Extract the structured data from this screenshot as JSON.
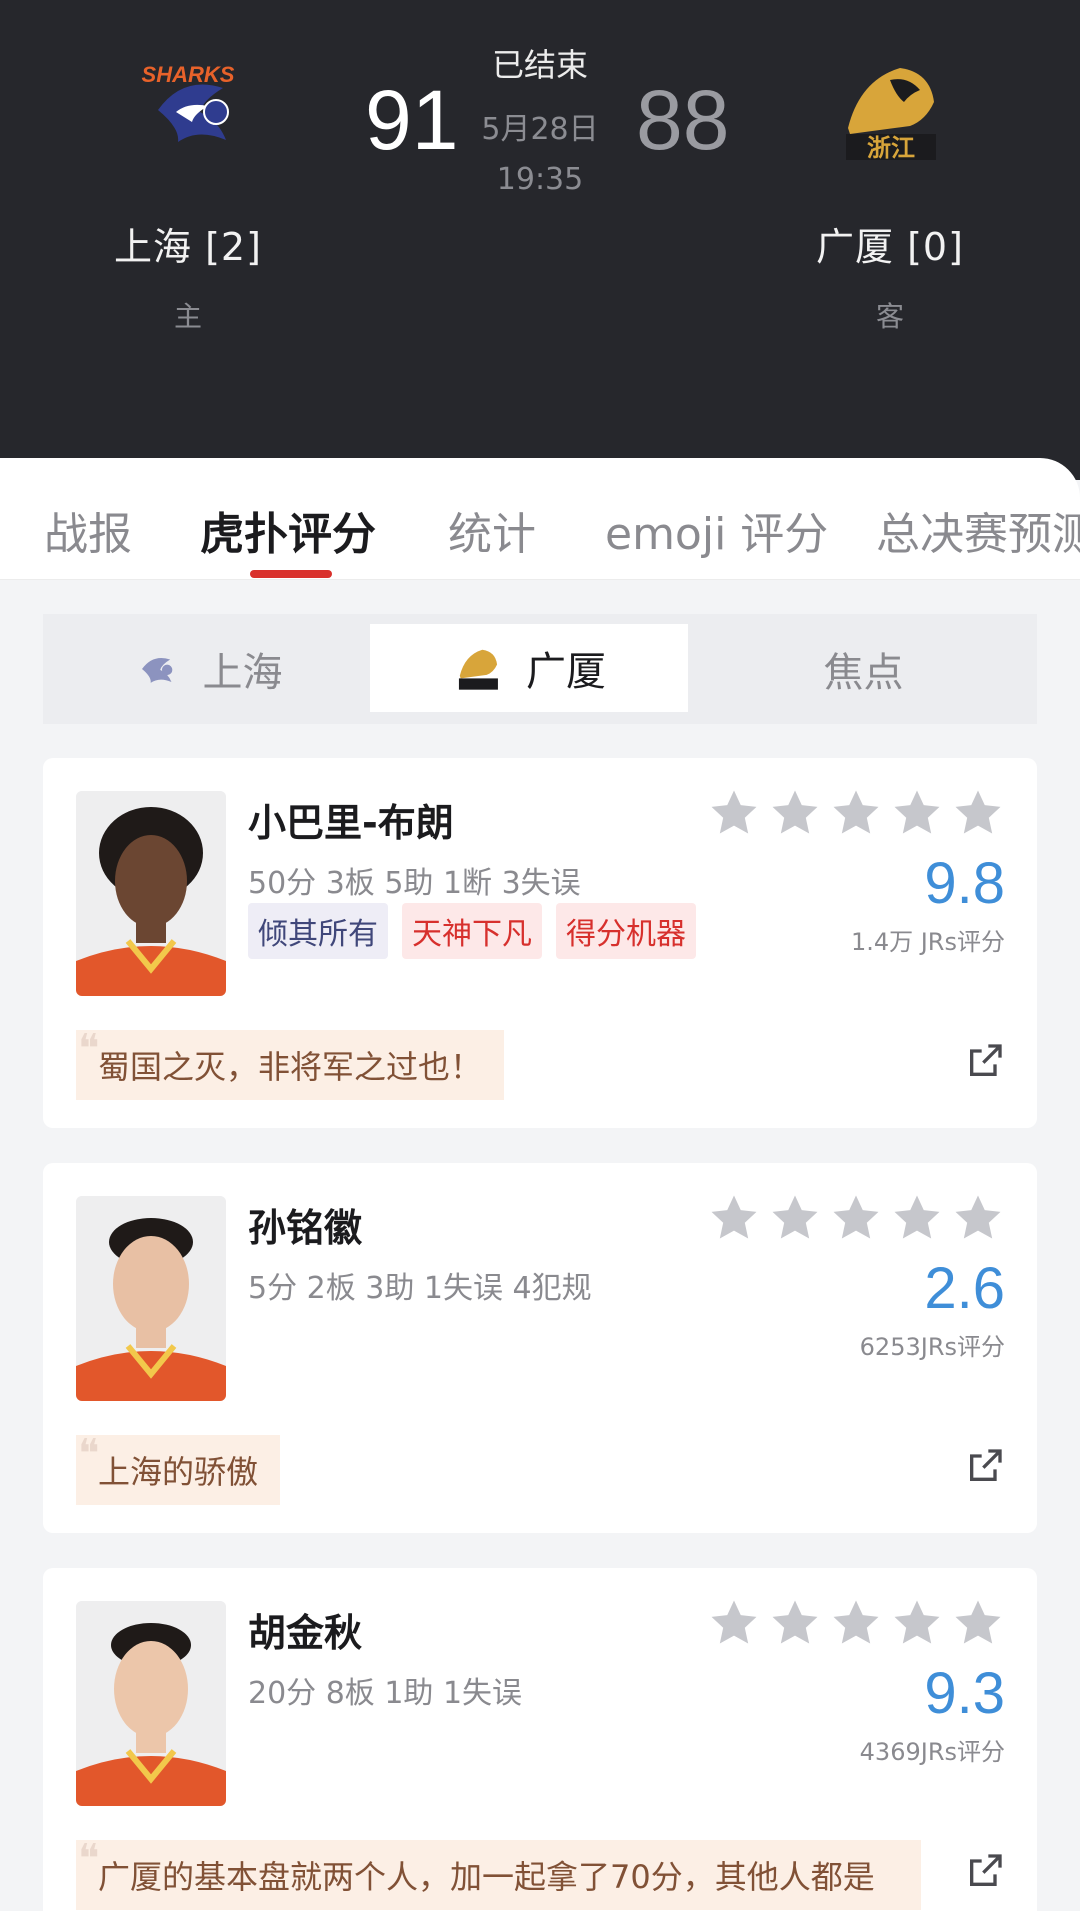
{
  "match": {
    "home": {
      "name": "上海 [2]",
      "role": "主",
      "score": "91",
      "logo": "sharks-logo"
    },
    "away": {
      "name": "广厦 [0]",
      "role": "客",
      "score": "88",
      "logo": "zj-lions-logo"
    },
    "status": "已结束",
    "date": "5月28日",
    "time": "19:35"
  },
  "tabs": [
    "战报",
    "虎扑评分",
    "统计",
    "emoji 评分",
    "总决赛预测"
  ],
  "active_tab": "虎扑评分",
  "team_switch": {
    "items": [
      {
        "label": "上海",
        "icon": "sharks-logo"
      },
      {
        "label": "广厦",
        "icon": "zj-lions-logo"
      },
      {
        "label": "焦点"
      }
    ],
    "active": "广厦"
  },
  "players": [
    {
      "name": "小巴里-布朗",
      "stats": "50分 3板 5助 1断 3失误",
      "tags": [
        {
          "text": "倾其所有",
          "style": "violet"
        },
        {
          "text": "天神下凡",
          "style": "red"
        },
        {
          "text": "得分机器",
          "style": "red"
        }
      ],
      "rating": "9.8",
      "rating_count": "1.4万 JRs评分",
      "comment": "蜀国之灭，非将军之过也！",
      "stars": 5
    },
    {
      "name": "孙铭徽",
      "stats": "5分 2板 3助 1失误 4犯规",
      "tags": [],
      "rating": "2.6",
      "rating_count": "6253JRs评分",
      "comment": "上海的骄傲",
      "stars": 5
    },
    {
      "name": "胡金秋",
      "stats": "20分 8板 1助 1失误",
      "tags": [],
      "rating": "9.3",
      "rating_count": "4369JRs评分",
      "comment": "广厦的基本盘就两个人，加一起拿了70分，其他人都是",
      "stars": 5
    }
  ],
  "colors": {
    "header_bg": "#26272c",
    "accent_red": "#d9302b",
    "rating_blue": "#3f8ed8",
    "star_gray": "#c6c7cc",
    "comment_bg": "#fcefe5"
  }
}
